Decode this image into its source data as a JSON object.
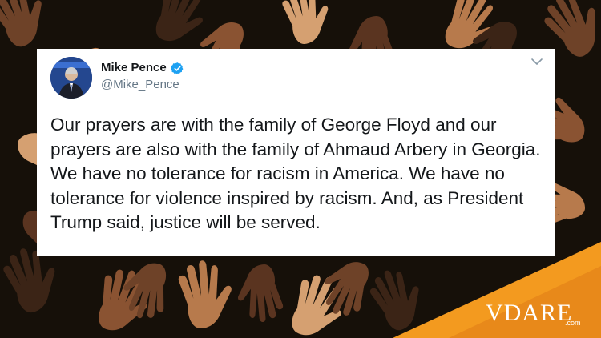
{
  "tweet": {
    "author_name": "Mike Pence",
    "author_handle": "@Mike_Pence",
    "verified": true,
    "text": "Our prayers are with the family of George Floyd and our prayers are also with the family of Ahmaud Arbery in Georgia. We have no tolerance for racism in America. We have no tolerance for violence inspired by racism. And, as President Trump said, justice will be served."
  },
  "icons": {
    "verified": "verified-badge-icon",
    "menu": "chevron-down-icon",
    "avatar": "profile-avatar"
  },
  "branding": {
    "logo": "VDARE",
    "logo_sub": ".com"
  },
  "colors": {
    "background": "#161009",
    "card": "#ffffff",
    "text": "#14171a",
    "handle": "#657786",
    "verified": "#1da1f2",
    "accent_orange": "#f39a1f",
    "hand_browns": [
      "#3b2416",
      "#5a3420",
      "#8a5332",
      "#b77a4c",
      "#d5a071",
      "#6e4228"
    ]
  }
}
